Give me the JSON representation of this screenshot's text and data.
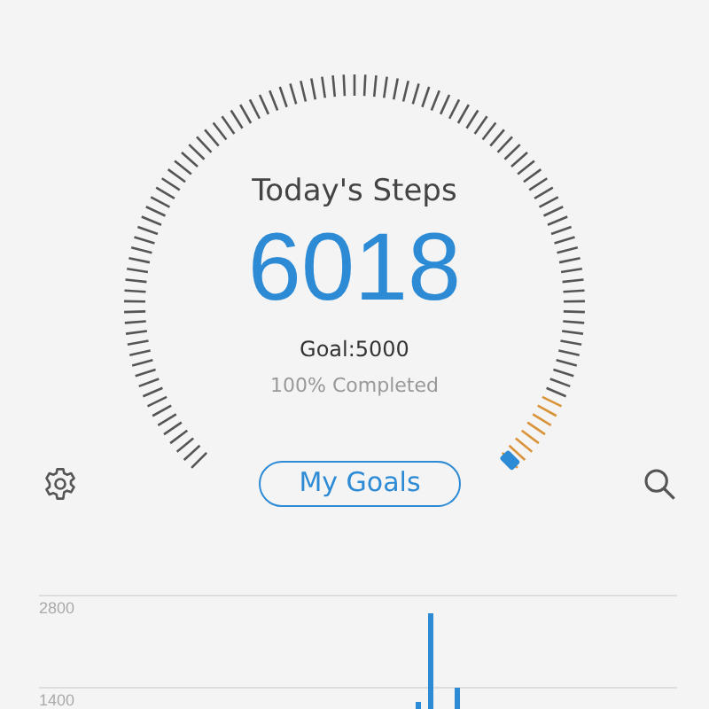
{
  "gauge": {
    "title": "Today's Steps",
    "steps": "6018",
    "goal": "Goal:5000",
    "completed": "100% Completed"
  },
  "goals_button": "My Goals",
  "chart": {
    "y_labels": [
      "2800",
      "1400"
    ]
  }
}
